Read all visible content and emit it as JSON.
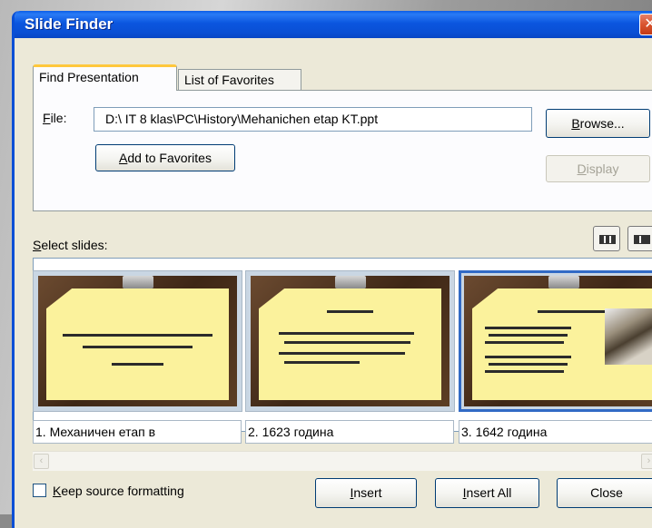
{
  "dialog": {
    "title": "Slide Finder",
    "close_glyph": "✕"
  },
  "tabs": [
    {
      "label": "Find Presentation",
      "active": true
    },
    {
      "label": "List of Favorites",
      "active": false
    }
  ],
  "file": {
    "label_accel": "F",
    "label_rest": "ile:",
    "value": "D:\\ IT 8 klas\\PC\\History\\Mehanichen etap KT.ppt"
  },
  "buttons": {
    "browse_accel": "B",
    "browse_rest": "rowse...",
    "add_favorites_accel": "A",
    "add_favorites_rest": "dd to Favorites",
    "display_accel": "D",
    "display_rest": "isplay",
    "insert_accel": "I",
    "insert_rest": "nsert",
    "insert_all_accel": "I",
    "insert_all_rest": "nsert All",
    "close": "Close"
  },
  "select_slides": {
    "label_accel": "S",
    "label_rest": "elect slides:"
  },
  "slides": [
    {
      "caption": "1. Механичен етап в",
      "selected": false
    },
    {
      "caption": "2. 1623 година",
      "selected": false
    },
    {
      "caption": "3. 1642 година",
      "selected": true
    }
  ],
  "keep_source": {
    "label_accel": "K",
    "label_rest": "eep source formatting",
    "checked": false
  },
  "icons": {
    "view_slides": "thumbnail-view-icon",
    "view_titles": "title-view-icon",
    "scroll_left": "‹",
    "scroll_right": "›"
  }
}
